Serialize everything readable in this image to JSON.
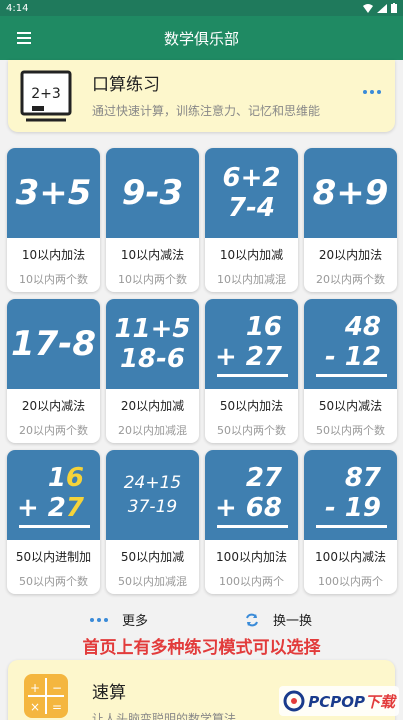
{
  "status": {
    "time": "4:14"
  },
  "app_bar": {
    "title": "数学俱乐部"
  },
  "feature_top": {
    "title": "口算练习",
    "desc": "通过快速计算，训练注意力、记忆和思维能",
    "icon_text": "2+3"
  },
  "tiles": [
    {
      "name": "10以内加法",
      "sub": "10以内两个数",
      "lines": [
        "3+5"
      ]
    },
    {
      "name": "10以内减法",
      "sub": "10以内两个数",
      "lines": [
        "9-3"
      ]
    },
    {
      "name": "10以内加减",
      "sub": "10以内加减混",
      "lines": [
        "6+2",
        "7-4"
      ]
    },
    {
      "name": "20以内加法",
      "sub": "20以内两个数",
      "lines": [
        "8+9"
      ]
    },
    {
      "name": "20以内减法",
      "sub": "20以内两个数",
      "lines": [
        "17-8"
      ]
    },
    {
      "name": "20以内加减",
      "sub": "20以内加减混",
      "lines": [
        "11+5",
        "18-6"
      ]
    },
    {
      "name": "50以内加法",
      "sub": "50以内两个数",
      "lines": [
        "16",
        "+ 27"
      ]
    },
    {
      "name": "50以内减法",
      "sub": "50以内两个数",
      "lines": [
        "48",
        "- 12"
      ]
    },
    {
      "name": "50以内进制加",
      "sub": "50以内两个数",
      "lines": [
        "1",
        "6",
        "+ 2",
        "7"
      ]
    },
    {
      "name": "50以内加减",
      "sub": "50以内加减混",
      "lines": [
        "24+15",
        "37-19"
      ]
    },
    {
      "name": "100以内加法",
      "sub": "100以内两个",
      "lines": [
        "27",
        "+ 68"
      ]
    },
    {
      "name": "100以内减法",
      "sub": "100以内两个",
      "lines": [
        "87",
        "- 19"
      ]
    }
  ],
  "actions": {
    "more": "更多",
    "swap": "换一换"
  },
  "caption": "首页上有多种练习模式可以选择",
  "feature_bottom": {
    "title": "速算",
    "desc": "让人头脑变聪明的数学算法"
  },
  "watermark": {
    "brand": "PCPOP",
    "suffix": "下载"
  },
  "colors": {
    "header": "#1f8a63",
    "tile": "#3f7fb0",
    "card": "#fdf7cc",
    "caption": "#e23b3b"
  }
}
